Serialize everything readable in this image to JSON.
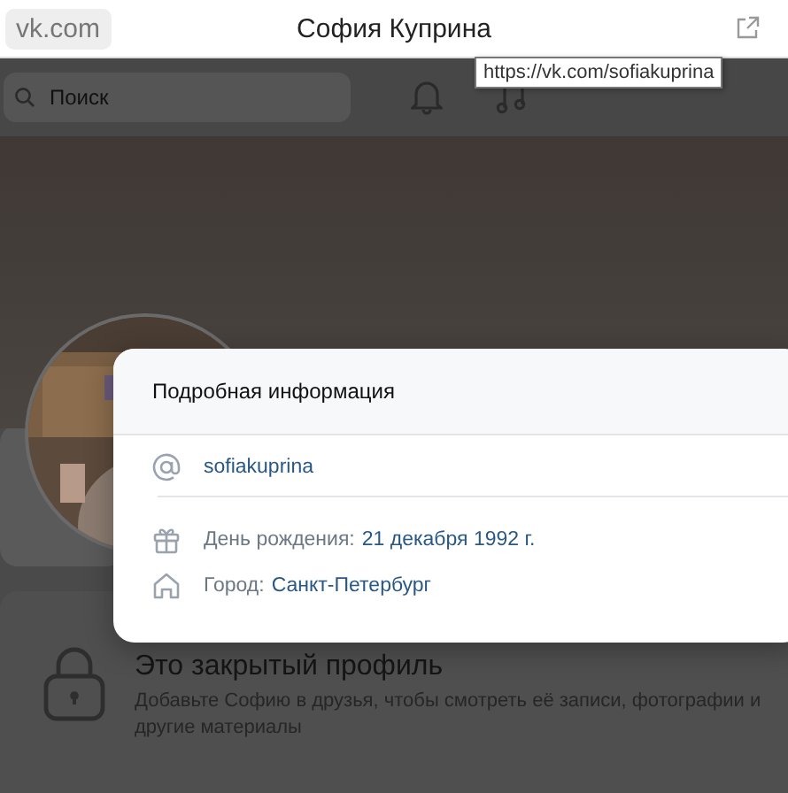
{
  "browser": {
    "site": "vk.com",
    "title": "София Куприна",
    "tooltip": "https://vk.com/sofiakuprina"
  },
  "header": {
    "search": {
      "placeholder": "Поиск"
    }
  },
  "modal": {
    "title": "Подробная информация",
    "sections": [
      [
        {
          "kind": "username",
          "value": "sofiakuprina"
        }
      ],
      [
        {
          "kind": "birthday",
          "label": "День рождения:",
          "value": "21 декабря 1992 г."
        },
        {
          "kind": "city",
          "label": "Город:",
          "value": "Санкт-Петербург"
        }
      ]
    ]
  },
  "private_profile": {
    "title": "Это закрытый профиль",
    "text": "Добавьте Софию в друзья, чтобы смотреть её записи, фотографии и другие материалы"
  }
}
